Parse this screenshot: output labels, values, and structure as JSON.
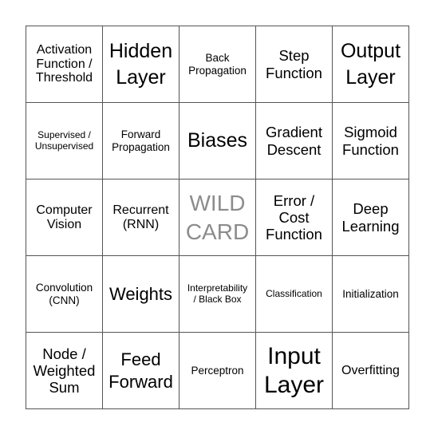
{
  "board": {
    "cells": [
      {
        "text": "Activation\nFunction /\nThreshold",
        "size": "md"
      },
      {
        "text": "Hidden\nLayer",
        "size": "xxl"
      },
      {
        "text": "Back\nPropagation",
        "size": "sm"
      },
      {
        "text": "Step\nFunction",
        "size": "lg"
      },
      {
        "text": "Output\nLayer",
        "size": "xxl"
      },
      {
        "text": "Supervised /\nUnsupervised",
        "size": "xs"
      },
      {
        "text": "Forward\nPropagation",
        "size": "sm"
      },
      {
        "text": "Biases",
        "size": "xxl"
      },
      {
        "text": "Gradient\nDescent",
        "size": "lg"
      },
      {
        "text": "Sigmoid\nFunction",
        "size": "lg"
      },
      {
        "text": "Computer\nVision",
        "size": "md"
      },
      {
        "text": "Recurrent\n(RNN)",
        "size": "md"
      },
      {
        "text": "WILD\nCARD",
        "size": "wild"
      },
      {
        "text": "Error /\nCost\nFunction",
        "size": "lg"
      },
      {
        "text": "Deep\nLearning",
        "size": "lg"
      },
      {
        "text": "Convolution\n(CNN)",
        "size": "sm"
      },
      {
        "text": "Weights",
        "size": "xl"
      },
      {
        "text": "Interpretability\n/ Black Box",
        "size": "xs"
      },
      {
        "text": "Classification",
        "size": "xs"
      },
      {
        "text": "Initialization",
        "size": "sm"
      },
      {
        "text": "Node /\nWeighted\nSum",
        "size": "lg"
      },
      {
        "text": "Feed\nForward",
        "size": "xl"
      },
      {
        "text": "Perceptron",
        "size": "sm"
      },
      {
        "text": "Input\nLayer",
        "size": "huge"
      },
      {
        "text": "Overfitting",
        "size": "md"
      }
    ]
  }
}
